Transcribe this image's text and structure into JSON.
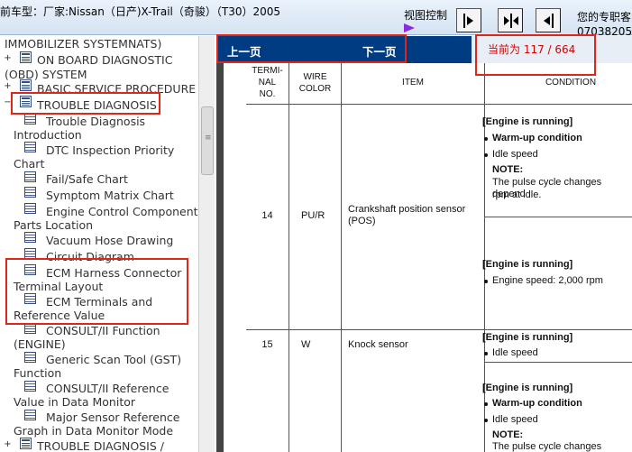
{
  "header": {
    "vehicle": "前车型：厂家:Nissan（日产)X-Trail（奇骏）（T30）2005",
    "view_control_label": "视图控制",
    "consultant_label": "您的专职客",
    "consultant_number": "07038205"
  },
  "tree": {
    "items": [
      {
        "label": "IMMOBILIZER SYSTEMNATS)"
      },
      {
        "label": "ON BOARD DIAGNOSTIC"
      },
      {
        "label": "(OBD) SYSTEM"
      },
      {
        "label": "BASIC SERVICE PROCEDURE"
      },
      {
        "label": "TROUBLE DIAGNOSIS"
      },
      {
        "label": "Trouble Diagnosis"
      },
      {
        "label": "Introduction"
      },
      {
        "label": "DTC Inspection Priority"
      },
      {
        "label": "Chart"
      },
      {
        "label": "Fail/Safe Chart"
      },
      {
        "label": "Symptom Matrix Chart"
      },
      {
        "label": "Engine Control Component"
      },
      {
        "label": "Parts Location"
      },
      {
        "label": "Vacuum Hose Drawing"
      },
      {
        "label": "Circuit Diagram"
      },
      {
        "label": "ECM Harness Connector"
      },
      {
        "label": "Terminal Layout"
      },
      {
        "label": "ECM Terminals and"
      },
      {
        "label": "Reference Value"
      },
      {
        "label": "CONSULT/II Function"
      },
      {
        "label": "(ENGINE)"
      },
      {
        "label": "Generic Scan Tool (GST)"
      },
      {
        "label": "Function"
      },
      {
        "label": "CONSULT/II Reference"
      },
      {
        "label": "Value in Data Monitor"
      },
      {
        "label": "Major Sensor Reference"
      },
      {
        "label": "Graph in Data Monitor Mode"
      },
      {
        "label": "TROUBLE DIAGNOSIS /"
      }
    ]
  },
  "nav": {
    "prev": "上一页",
    "next": "下一页",
    "page_indicator": "当前为 117 / 664"
  },
  "table": {
    "headers": {
      "terminal_line1": "TERMI-",
      "terminal_line2": "NAL",
      "terminal_line3": "NO.",
      "wire_line1": "WIRE",
      "wire_line2": "COLOR",
      "item": "ITEM",
      "condition": "CONDITION"
    },
    "rows": [
      {
        "terminal": "14",
        "wire": "PU/R",
        "item_line1": "Crankshaft position sensor",
        "item_line2": "(POS)",
        "cond1": {
          "state": "[Engine is running]",
          "bullet1": "Warm-up condition",
          "bullet2": "Idle speed",
          "note": "NOTE:",
          "note_line1": "The pulse cycle changes depend",
          "note_line2": "rpm at idle."
        },
        "cond2": {
          "state": "[Engine is running]",
          "bullet1": "Engine speed: 2,000 rpm"
        }
      },
      {
        "terminal": "15",
        "wire": "W",
        "item_line1": "Knock sensor",
        "cond1": {
          "state": "[Engine is running]",
          "bullet1": "Idle speed"
        },
        "cond2": {
          "state": "[Engine is running]",
          "bullet1": "Warm-up condition",
          "bullet2": "Idle speed",
          "note": "NOTE:",
          "note_line1": "The pulse cycle changes depend"
        }
      }
    ]
  },
  "colors": {
    "nav_background": "#003c82",
    "page_indicator": "#d40000",
    "annotation_box": "#e0251b",
    "view_marker": "#8a2be2"
  }
}
